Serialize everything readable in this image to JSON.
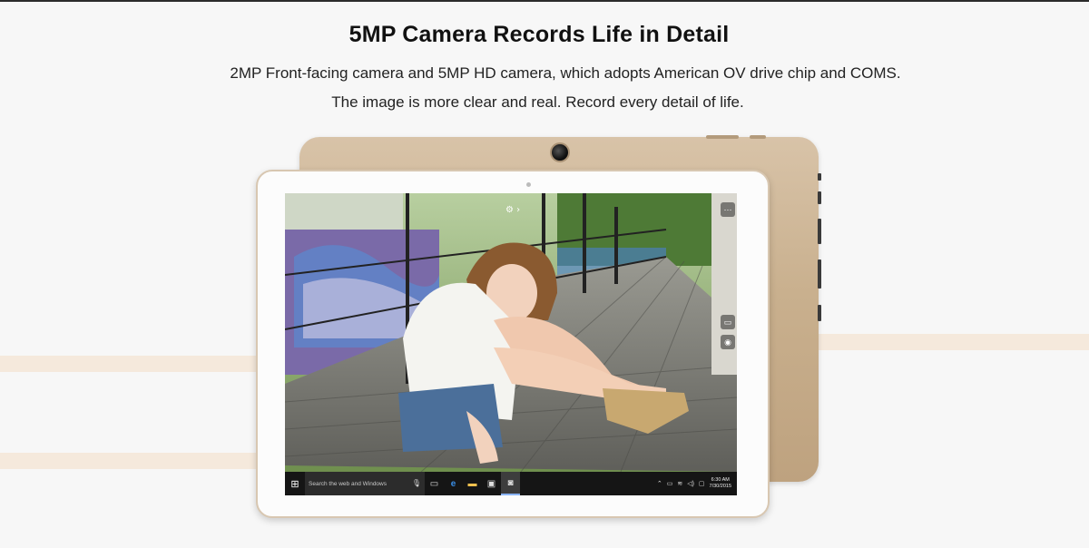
{
  "header": {
    "title": "5MP Camera Records Life in Detail",
    "subtitle_line1": "2MP Front-facing camera and 5MP HD camera, which adopts American OV drive chip and COMS.",
    "subtitle_line2": "The image is more clear and real. Record every detail of life."
  },
  "colors": {
    "accent_band": "#f5e9dc",
    "tablet_gold": "#c9b08e",
    "tablet_white": "#fcfcfc",
    "taskbar": "#151515"
  },
  "taskbar": {
    "search_placeholder": "Search the web and Windows",
    "start_icon": "windows-logo-icon",
    "mic_icon": "microphone-icon",
    "apps": [
      "task-view-icon",
      "edge-icon",
      "file-explorer-icon",
      "store-icon",
      "camera-icon"
    ],
    "tray_icons": [
      "chevron-up-icon",
      "battery-icon",
      "network-icon",
      "volume-icon",
      "notification-icon"
    ],
    "time": "6:30 AM",
    "date": "7/30/2015"
  },
  "camera_app": {
    "controls": [
      "more-icon",
      "video-icon",
      "photo-icon"
    ]
  }
}
